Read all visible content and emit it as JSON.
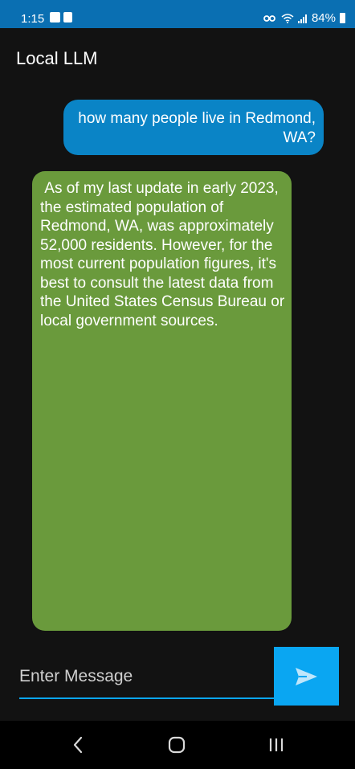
{
  "status_bar": {
    "time": "1:15",
    "battery": "84%",
    "icons": [
      "image-icon",
      "cast-icon",
      "key-icon",
      "wifi-icon",
      "signal-icon",
      "battery-icon"
    ]
  },
  "app": {
    "title": "Local LLM"
  },
  "messages": [
    {
      "role": "user",
      "text": "how many people live in Redmond, WA?"
    },
    {
      "role": "assistant",
      "text": " As of my last update in early 2023, the estimated population of Redmond, WA, was approximately 52,000 residents. However, for the most current population figures, it's best to consult the latest data from the United States Census Bureau or local government sources."
    }
  ],
  "composer": {
    "placeholder": "Enter Message",
    "value": ""
  },
  "colors": {
    "status_bar": "#0a6fb2",
    "user_bubble": "#0a84c6",
    "assistant_bubble": "#6a9a3c",
    "accent": "#0aa6f2",
    "background": "#121212"
  },
  "nav": {
    "icons": [
      "back-icon",
      "home-icon",
      "recents-icon"
    ]
  }
}
